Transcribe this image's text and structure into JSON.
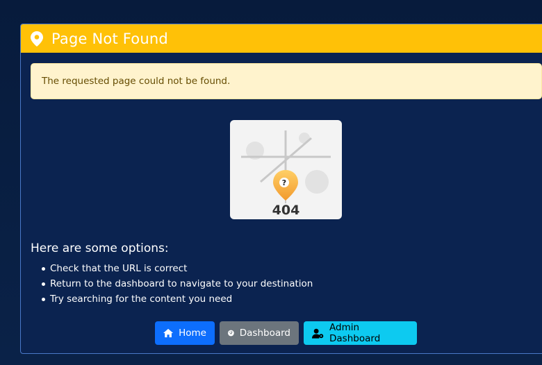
{
  "card": {
    "title": "Page Not Found",
    "header_color": "#ffc107",
    "icons": {
      "header": "map-pin-icon"
    }
  },
  "alert": {
    "message": "The requested page could not be found."
  },
  "illustration": {
    "code": "404",
    "marker_symbol": "?"
  },
  "options": {
    "heading": "Here are some options:",
    "items": [
      "Check that the URL is correct",
      "Return to the dashboard to navigate to your destination",
      "Try searching for the content you need"
    ]
  },
  "buttons": {
    "home": {
      "label": "Home",
      "icon": "home-icon",
      "color": "#0d6efd"
    },
    "dashboard": {
      "label": "Dashboard",
      "icon": "gauge-icon",
      "color": "#6c757d"
    },
    "admin": {
      "label": "Admin Dashboard",
      "icon": "user-cog-icon",
      "color": "#0dcaf0"
    }
  }
}
